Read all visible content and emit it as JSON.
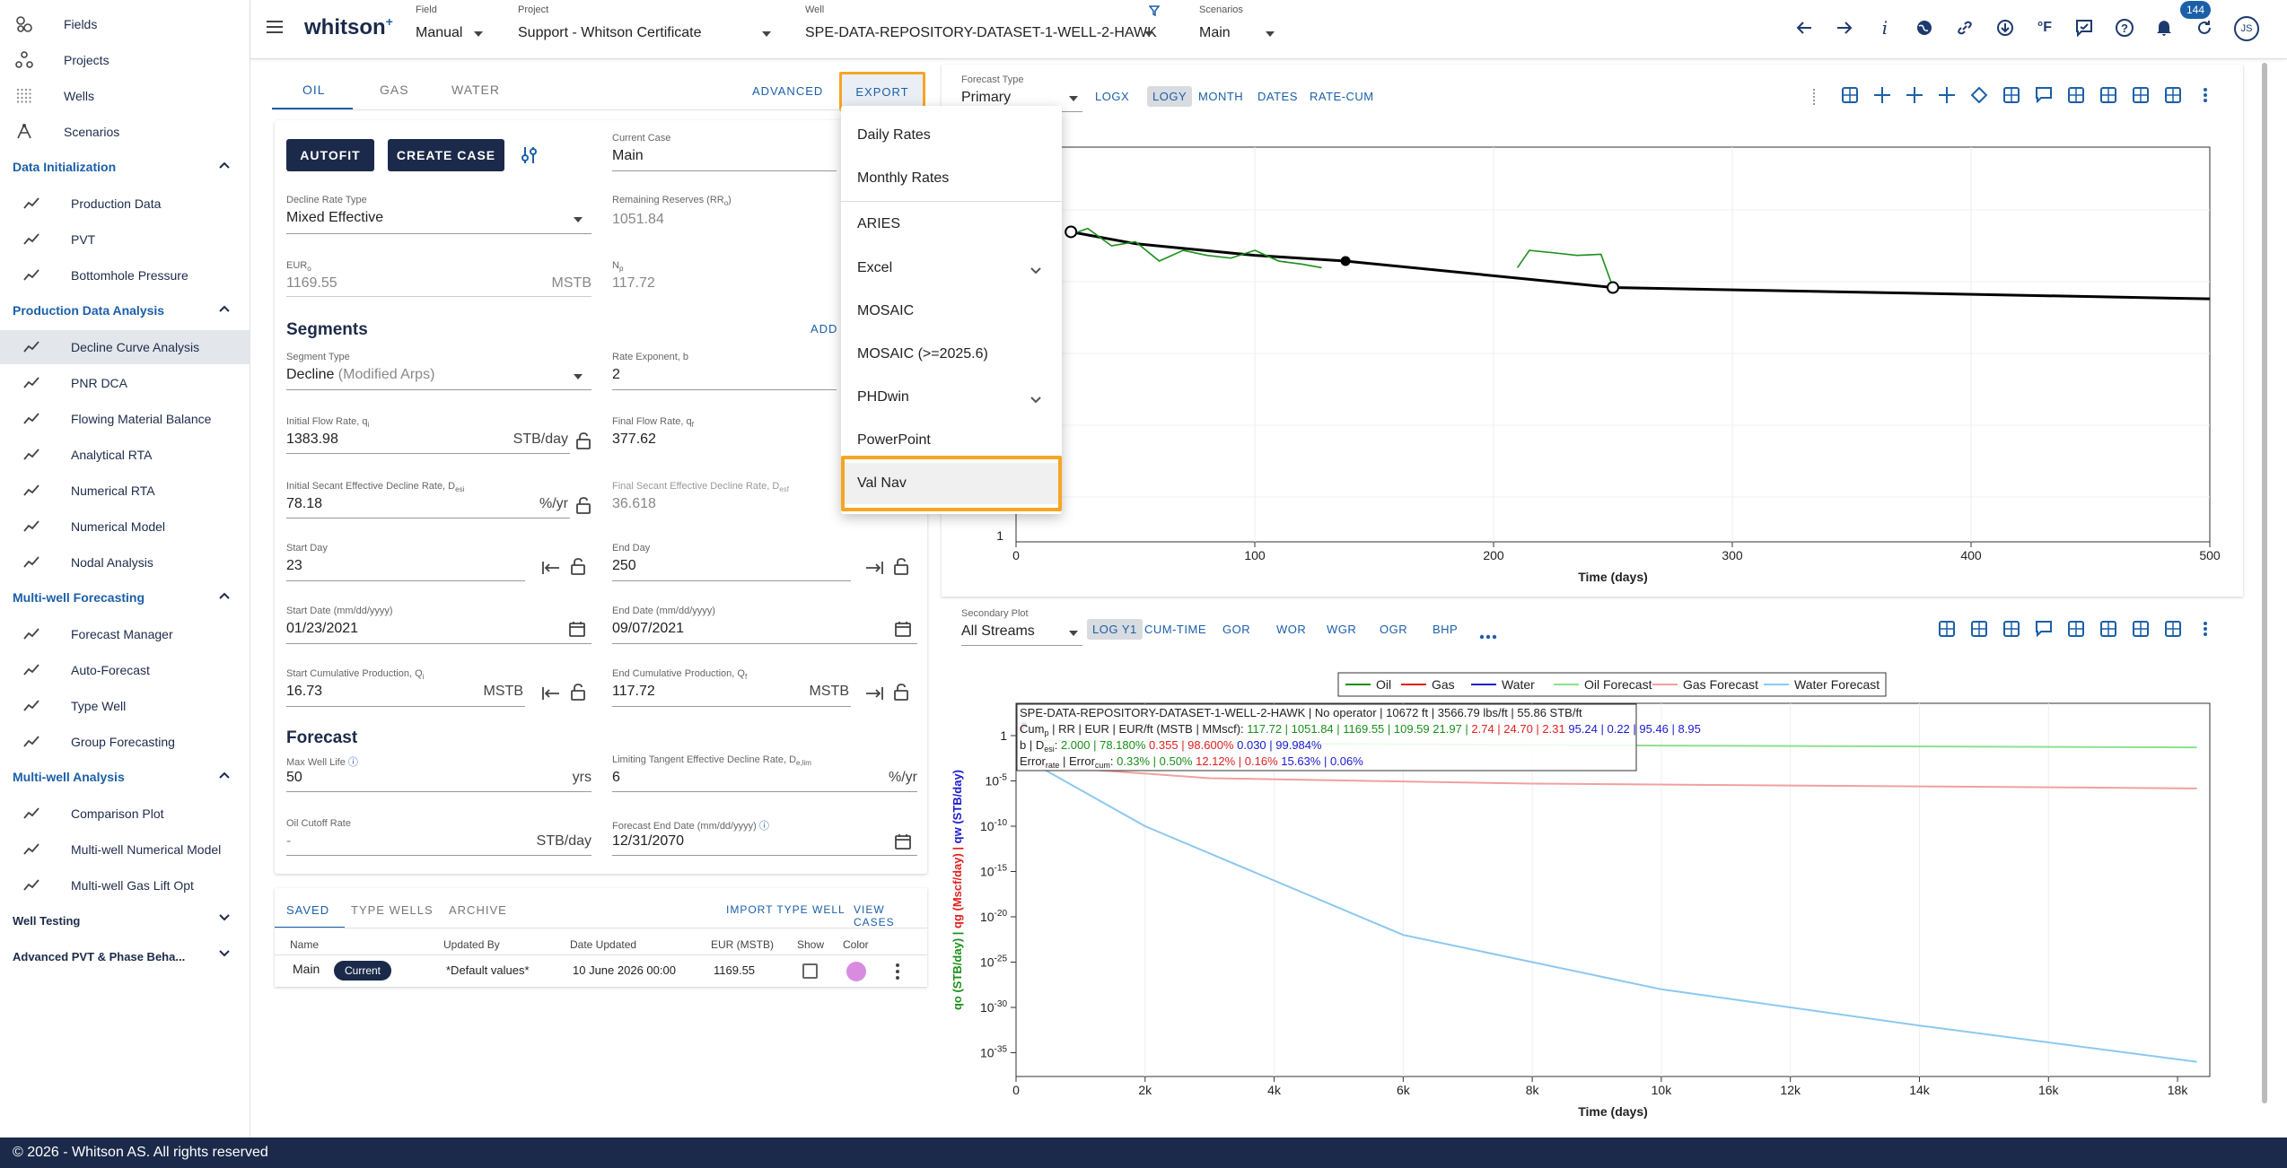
{
  "app": {
    "logo": "whitson",
    "logo_sup": "+",
    "footer": "© 2026 - Whitson AS. All rights reserved"
  },
  "sidebar": {
    "top_items": [
      {
        "label": "Fields",
        "icon": "fields-icon"
      },
      {
        "label": "Projects",
        "icon": "projects-icon"
      },
      {
        "label": "Wells",
        "icon": "wells-icon"
      },
      {
        "label": "Scenarios",
        "icon": "scenarios-icon"
      }
    ],
    "sections": [
      {
        "title": "Data Initialization",
        "items": [
          "Production Data",
          "PVT",
          "Bottomhole Pressure"
        ]
      },
      {
        "title": "Production Data Analysis",
        "items": [
          "Decline Curve Analysis",
          "PNR DCA",
          "Flowing Material Balance",
          "Analytical RTA",
          "Numerical RTA",
          "Numerical Model",
          "Nodal Analysis"
        ]
      },
      {
        "title": "Multi-well Forecasting",
        "items": [
          "Forecast Manager",
          "Auto-Forecast",
          "Type Well",
          "Group Forecasting"
        ]
      },
      {
        "title": "Multi-well Analysis",
        "items": [
          "Comparison Plot",
          "Multi-well Numerical Model",
          "Multi-well Gas Lift Opt"
        ]
      }
    ],
    "collapsed": [
      "Well Testing",
      "Advanced PVT & Phase Beha..."
    ]
  },
  "header": {
    "field_label": "Field",
    "field_value": "Manual",
    "project_label": "Project",
    "project_value": "Support - Whitson Certificate",
    "well_label": "Well",
    "well_value": "SPE-DATA-REPOSITORY-DATASET-1-WELL-2-HAWK",
    "scenarios_label": "Scenarios",
    "scenarios_value": "Main",
    "notif_count": "144",
    "user_initials": "JS"
  },
  "left": {
    "tabs": [
      "OIL",
      "GAS",
      "WATER"
    ],
    "advanced": "ADVANCED",
    "export": "EXPORT",
    "autofit": "AUTOFIT",
    "create_case": "CREATE CASE",
    "current_case_label": "Current Case",
    "current_case": "Main",
    "decline_type_label": "Decline Rate Type",
    "decline_type": "Mixed Effective",
    "rr_label": "Remaining Reserves (RR",
    "rr_sub": "o",
    "rr_label_end": ")",
    "rr_value": "1051.84",
    "eur_label": "EUR",
    "eur_sub": "o",
    "eur_value": "1169.55",
    "eur_unit": "MSTB",
    "np_label": "N",
    "np_sub": "p",
    "np_value": "117.72",
    "segments_title": "Segments",
    "add_link": "ADD",
    "seg_type_label": "Segment Type",
    "seg_type": "Decline",
    "seg_type_extra": " (Modified Arps)",
    "rate_exp_label": "Rate Exponent, b",
    "rate_exp": "2",
    "qi_label": "Initial Flow Rate, q",
    "qi_sub": "i",
    "qi_value": "1383.98",
    "qi_unit": "STB/day",
    "qf_label": "Final Flow Rate, q",
    "qf_sub": "f",
    "qf_value": "377.62",
    "desi_label": "Initial Secant Effective Decline Rate, D",
    "desi_sub": "esi",
    "desi_value": "78.18",
    "desi_unit": "%/yr",
    "desf_label": "Final Secant Effective Decline Rate, D",
    "desf_sub": "esf",
    "desf_value": "36.618",
    "start_day_label": "Start Day",
    "start_day": "23",
    "end_day_label": "End Day",
    "end_day": "250",
    "start_date_label": "Start Date (mm/dd/yyyy)",
    "start_date": "01/23/2021",
    "end_date_label": "End Date (mm/dd/yyyy)",
    "end_date": "09/07/2021",
    "qi_cum_label": "Start Cumulative Production, Q",
    "qi_cum_sub": "i",
    "qi_cum": "16.73",
    "qi_cum_unit": "MSTB",
    "qf_cum_label": "End Cumulative Production, Q",
    "qf_cum_sub": "f",
    "qf_cum": "117.72",
    "qf_cum_unit": "MSTB",
    "forecast_title": "Forecast",
    "mwl_label": "Max Well Life",
    "mwl": "50",
    "mwl_unit": "yrs",
    "ltd_label": "Limiting Tangent Effective Decline Rate, D",
    "ltd_sub": "e,lim",
    "ltd": "6",
    "ltd_unit": "%/yr",
    "cutoff_label": "Oil Cutoff Rate",
    "cutoff": "-",
    "cutoff_unit": "STB/day",
    "fed_label": "Forecast End Date (mm/dd/yyyy)",
    "fed": "12/31/2070",
    "bottom_tabs": [
      "SAVED",
      "TYPE WELLS",
      "ARCHIVE"
    ],
    "import_type_well": "IMPORT TYPE WELL",
    "view_cases": "VIEW CASES",
    "table_headers": [
      "Name",
      "Updated By",
      "Date Updated",
      "EUR (MSTB)",
      "Show",
      "Color"
    ],
    "table_row": {
      "name": "Main",
      "badge": "Current",
      "updated_by": "*Default values*",
      "date": "10 June 2026 00:00",
      "eur": "1169.55",
      "color": "#d98be0"
    }
  },
  "export_menu": {
    "items": [
      "Daily Rates",
      "Monthly Rates",
      "ARIES",
      "Excel",
      "MOSAIC",
      "MOSAIC (>=2025.6)",
      "PHDwin",
      "PowerPoint",
      "Val Nav"
    ],
    "has_submenu": [
      "Excel",
      "PHDwin"
    ],
    "highlighted": "Val Nav"
  },
  "top_chart": {
    "forecast_type_label": "Forecast Type",
    "forecast_type": "Primary",
    "buttons": [
      "LOGX",
      "LOGY",
      "MONTH",
      "DATES",
      "RATE-CUM"
    ],
    "selected": "LOGY",
    "y_tick_label": "1"
  },
  "bottom_chart": {
    "secondary_label": "Secondary Plot",
    "secondary_value": "All Streams",
    "buttons": [
      "LOG Y1",
      "CUM-TIME",
      "GOR",
      "WOR",
      "WGR",
      "OGR",
      "BHP"
    ],
    "selected": "LOG Y1",
    "legend": [
      {
        "name": "Oil",
        "color": "#1a8f1a"
      },
      {
        "name": "Gas",
        "color": "#e02020"
      },
      {
        "name": "Water",
        "color": "#1a1ad0"
      },
      {
        "name": "Oil Forecast",
        "color": "#8ee08e"
      },
      {
        "name": "Gas Forecast",
        "color": "#f0a0a0"
      },
      {
        "name": "Water Forecast",
        "color": "#8cc8f0"
      }
    ],
    "info_line1": "SPE-DATA-REPOSITORY-DATASET-1-WELL-2-HAWK | No operator | 10672 ft | 3566.79 lbs/ft | 55.86 STB/ft",
    "info_line2_label": "Cum",
    "info_line2_sub": "p",
    "info_line2_rest": " | RR | EUR | EUR/ft (MSTB | MMscf): ",
    "info_line2_vals": [
      {
        "t": "117.72 | 1051.84 | 1169.55 | 109.59 21.97 | ",
        "c": "#1a8f1a"
      },
      {
        "t": "2.74 | 24.70 | 2.31 ",
        "c": "#e02020"
      },
      {
        "t": "95.24 | 0.22 | 95.46 | 8.95",
        "c": "#1a1ad0"
      }
    ],
    "info_line3_label": "b | D",
    "info_line3_sub": "esi",
    "info_line3_colon": ": ",
    "info_line3_vals": [
      {
        "t": "2.000 | 78.180% ",
        "c": "#1a8f1a"
      },
      {
        "t": "0.355 | 98.600% ",
        "c": "#e02020"
      },
      {
        "t": "0.030 | 99.984%",
        "c": "#1a1ad0"
      }
    ],
    "info_line4_label": "Error",
    "info_line4_sub1": "rate",
    "info_line4_mid": " | Error",
    "info_line4_sub2": "cum",
    "info_line4_colon": ": ",
    "info_line4_vals": [
      {
        "t": "0.33% | 0.50% ",
        "c": "#1a8f1a"
      },
      {
        "t": "12.12% | 0.16% ",
        "c": "#e02020"
      },
      {
        "t": "15.63% | 0.06%",
        "c": "#1a1ad0"
      }
    ]
  },
  "chart_data": [
    {
      "type": "line",
      "xlabel": "Time (days)",
      "ylabel": "",
      "xlim": [
        0,
        500
      ],
      "x_ticks": [
        "0",
        "100",
        "200",
        "300",
        "400",
        "500"
      ],
      "y_scale": "log",
      "y_ticks": [
        "1"
      ],
      "series": [
        {
          "color": "#000000",
          "x": [
            23,
            50,
            100,
            138,
            250,
            500
          ],
          "y": [
            1383.98,
            1050,
            800,
            700,
            377.62,
            290
          ]
        },
        {
          "color": "#1a8f1a",
          "x": [
            23,
            30,
            40,
            50,
            60,
            70,
            80,
            90,
            100,
            110,
            120,
            128
          ],
          "y": [
            1300,
            1500,
            1000,
            1100,
            700,
            900,
            800,
            750,
            900,
            700,
            650,
            600
          ]
        },
        {
          "color": "#1a8f1a",
          "x": [
            210,
            215,
            225,
            235,
            245,
            250
          ],
          "y": [
            600,
            900,
            850,
            800,
            820,
            380
          ]
        }
      ],
      "markers": [
        {
          "x": 23,
          "y": 1383.98,
          "style": "open"
        },
        {
          "x": 138,
          "y": 700,
          "style": "filled"
        },
        {
          "x": 250,
          "y": 377.62,
          "style": "open"
        }
      ]
    },
    {
      "type": "line",
      "xlabel": "Time (days)",
      "ylabel": "qo (STB/day) | qg (Mscf/day) | qw (STB/day)",
      "xlim": [
        0,
        18500
      ],
      "x_ticks": [
        "0",
        "2k",
        "4k",
        "6k",
        "8k",
        "10k",
        "12k",
        "14k",
        "16k",
        "18k"
      ],
      "y_scale": "log",
      "y_ticks": [
        "1",
        "10-5",
        "10-10",
        "10-15",
        "10-20",
        "10-25",
        "10-30",
        "10-35"
      ],
      "series": [
        {
          "name": "Oil Forecast",
          "color": "#8ee08e",
          "x": [
            250,
            5000,
            10000,
            18300
          ],
          "y": [
            0.3,
            0.12,
            0.08,
            0.05
          ]
        },
        {
          "name": "Gas Forecast",
          "color": "#f0a0a0",
          "x": [
            250,
            3000,
            8000,
            18300
          ],
          "y": [
            0.0005,
            2e-05,
            5e-06,
            1.5e-06
          ]
        },
        {
          "name": "Water Forecast",
          "color": "#8cc8f0",
          "x": [
            250,
            2000,
            6000,
            10000,
            14000,
            18300
          ],
          "y": [
            0.001,
            1e-10,
            1e-22,
            1e-28,
            1e-32,
            1e-36
          ]
        }
      ]
    }
  ]
}
